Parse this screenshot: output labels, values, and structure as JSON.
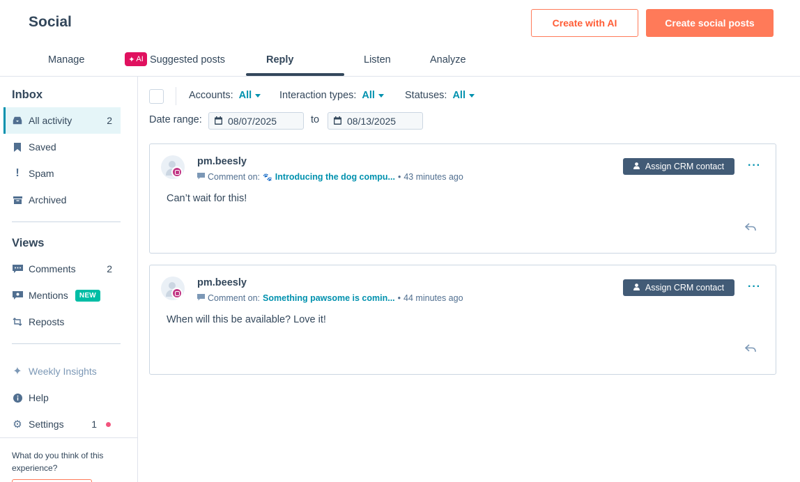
{
  "header": {
    "title": "Social",
    "create_ai_label": "Create with AI",
    "create_posts_label": "Create social posts"
  },
  "tabs": [
    {
      "label": "Manage"
    },
    {
      "label": "Suggested posts",
      "badge": "AI"
    },
    {
      "label": "Reply",
      "active": true
    },
    {
      "label": "Listen"
    },
    {
      "label": "Analyze"
    }
  ],
  "sidebar": {
    "inbox_heading": "Inbox",
    "inbox_items": [
      {
        "label": "All activity",
        "count": "2",
        "icon": "inbox-icon",
        "active": true
      },
      {
        "label": "Saved",
        "icon": "bookmark-icon"
      },
      {
        "label": "Spam",
        "icon": "exclamation-icon"
      },
      {
        "label": "Archived",
        "icon": "archive-icon"
      }
    ],
    "views_heading": "Views",
    "views_items": [
      {
        "label": "Comments",
        "count": "2",
        "icon": "comment-icon"
      },
      {
        "label": "Mentions",
        "badge": "NEW",
        "icon": "mention-icon"
      },
      {
        "label": "Reposts",
        "icon": "repost-icon"
      }
    ],
    "footer_items": [
      {
        "label": "Weekly Insights",
        "icon": "sparkle-icon"
      },
      {
        "label": "Help",
        "icon": "info-icon"
      },
      {
        "label": "Settings",
        "count": "1",
        "icon": "gear-icon"
      }
    ],
    "feedback_text": "What do you think of this experience?"
  },
  "filters": {
    "accounts_label": "Accounts:",
    "accounts_value": "All",
    "interaction_label": "Interaction types:",
    "interaction_value": "All",
    "statuses_label": "Statuses:",
    "statuses_value": "All",
    "date_range_label": "Date range:",
    "date_from": "08/07/2025",
    "date_to_label": "to",
    "date_to": "08/13/2025"
  },
  "posts": [
    {
      "username": "pm.beesly",
      "comment_on_label": "Comment on:",
      "post_title": "Introducing the dog compu...",
      "time": "43 minutes ago",
      "comment": "Can’t wait for this!",
      "assign_label": "Assign CRM contact"
    },
    {
      "username": "pm.beesly",
      "comment_on_label": "Comment on:",
      "post_title": "Something pawsome is comin...",
      "time": "44 minutes ago",
      "comment": "When will this be available? Love it!",
      "assign_label": "Assign CRM contact"
    }
  ],
  "colors": {
    "accent_orange": "#ff7a59",
    "link_teal": "#0091ae",
    "dark_slate": "#33475b",
    "assign_btn": "#425b76",
    "ai_pink": "#e0115f",
    "new_green": "#00bda5"
  }
}
